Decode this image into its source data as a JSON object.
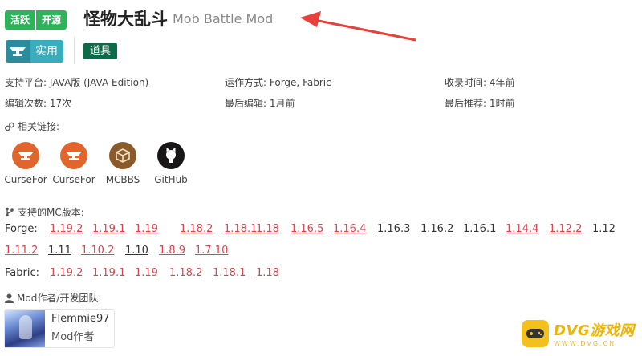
{
  "header": {
    "badges": [
      "活跃",
      "开源"
    ],
    "title": "怪物大乱斗",
    "subtitle": "Mob Battle Mod"
  },
  "tags": {
    "practical": "实用",
    "tool": "道具"
  },
  "info": {
    "platform_label": "支持平台:",
    "platform_value": "JAVA版 (JAVA Edition)",
    "runtime_label": "运作方式:",
    "runtime_forge": "Forge",
    "runtime_sep": ", ",
    "runtime_fabric": "Fabric",
    "collected_label": "收录时间:",
    "collected_value": "4年前",
    "edits_label": "编辑次数:",
    "edits_value": "17次",
    "last_edit_label": "最后编辑:",
    "last_edit_value": "1月前",
    "last_recommend_label": "最后推荐:",
    "last_recommend_value": "1时前"
  },
  "links": {
    "heading": "相关链接:",
    "items": [
      {
        "label": "CurseFor",
        "icon": "curseforge-anvil-icon"
      },
      {
        "label": "CurseFor",
        "icon": "curseforge-anvil-icon"
      },
      {
        "label": "MCBBS",
        "icon": "mcbbs-box-icon"
      },
      {
        "label": "GitHub",
        "icon": "github-icon"
      }
    ]
  },
  "versions": {
    "heading": "支持的MC版本:",
    "forge_label": "Forge:",
    "forge_row1": [
      {
        "v": "1.19.2",
        "c": "red"
      },
      {
        "v": "1.19.1",
        "c": "red"
      },
      {
        "v": "1.19",
        "c": "red"
      },
      {
        "v": "1.18.2",
        "c": "red"
      },
      {
        "v": "1.18.1",
        "c": "red"
      },
      {
        "v": "1.18",
        "c": "red"
      },
      {
        "v": "1.16.5",
        "c": "red"
      },
      {
        "v": "1.16.4",
        "c": "red"
      },
      {
        "v": "1.16.3",
        "c": "gray"
      },
      {
        "v": "1.16.2",
        "c": "gray"
      },
      {
        "v": "1.16.1",
        "c": "gray"
      },
      {
        "v": "1.14.4",
        "c": "red"
      },
      {
        "v": "1.12.2",
        "c": "red"
      },
      {
        "v": "1.12",
        "c": "gray"
      }
    ],
    "forge_row2": [
      {
        "v": "1.11.2",
        "c": "red"
      },
      {
        "v": "1.11",
        "c": "gray"
      },
      {
        "v": "1.10.2",
        "c": "red"
      },
      {
        "v": "1.10",
        "c": "gray"
      },
      {
        "v": "1.8.9",
        "c": "red"
      },
      {
        "v": "1.7.10",
        "c": "red"
      }
    ],
    "fabric_label": "Fabric:",
    "fabric_row": [
      {
        "v": "1.19.2",
        "c": "red"
      },
      {
        "v": "1.19.1",
        "c": "red"
      },
      {
        "v": "1.19",
        "c": "red"
      },
      {
        "v": "1.18.2",
        "c": "red"
      },
      {
        "v": "1.18.1",
        "c": "red"
      },
      {
        "v": "1.18",
        "c": "red"
      }
    ]
  },
  "authors": {
    "heading": "Mod作者/开发团队:",
    "name": "Flemmie97",
    "role": "Mod作者"
  },
  "watermark": {
    "main": "DVG游戏网",
    "sub": "WWW.DVG.CN"
  },
  "colors": {
    "active_green": "#2fb35a",
    "practical_teal": "#39adbd",
    "tool_green": "#0e6b4a",
    "version_red": "#e0424b",
    "annotation_arrow": "#e8413c"
  }
}
